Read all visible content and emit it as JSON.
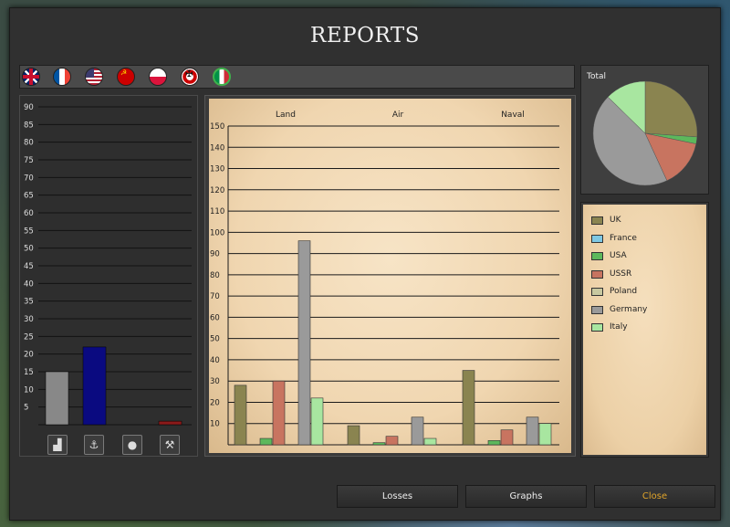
{
  "window": {
    "title": "REPORTS"
  },
  "nations": [
    {
      "name": "uk-flag-icon"
    },
    {
      "name": "france-flag-icon"
    },
    {
      "name": "usa-flag-icon"
    },
    {
      "name": "ussr-flag-icon"
    },
    {
      "name": "poland-flag-icon"
    },
    {
      "name": "germany-flag-icon"
    },
    {
      "name": "italy-flag-icon"
    }
  ],
  "resource_panel": {
    "ticks": [
      "90",
      "85",
      "80",
      "75",
      "70",
      "65",
      "60",
      "55",
      "50",
      "45",
      "40",
      "35",
      "30",
      "25",
      "20",
      "15",
      "10",
      "5"
    ],
    "buttons": [
      {
        "icon": "factory-icon",
        "glyph": "▟"
      },
      {
        "icon": "anchor-icon",
        "glyph": "⚓"
      },
      {
        "icon": "oil-drop-icon",
        "glyph": "💧"
      },
      {
        "icon": "mining-hammers-icon",
        "glyph": "⚒"
      }
    ],
    "colors": {
      "grey": "#888888",
      "navy": "#0a0a80",
      "red": "#8b1a1a"
    }
  },
  "chart_data": [
    {
      "type": "bar",
      "categories": [
        "Land",
        "Air",
        "Naval"
      ],
      "ylim": [
        0,
        150
      ],
      "yticks": [
        "150",
        "140",
        "130",
        "120",
        "110",
        "100",
        "90",
        "80",
        "70",
        "60",
        "50",
        "40",
        "30",
        "20",
        "10"
      ],
      "series": [
        {
          "name": "UK",
          "color": "#8a8450",
          "values": [
            28,
            9,
            35
          ]
        },
        {
          "name": "France",
          "color": "#7ec8e3",
          "values": [
            0,
            0,
            0
          ]
        },
        {
          "name": "USA",
          "color": "#5cb85c",
          "values": [
            3,
            1,
            2
          ]
        },
        {
          "name": "USSR",
          "color": "#c87460",
          "values": [
            30,
            4,
            7
          ]
        },
        {
          "name": "Poland",
          "color": "#c8c8a0",
          "values": [
            0,
            0,
            0
          ]
        },
        {
          "name": "Germany",
          "color": "#9a9a9a",
          "values": [
            96,
            13,
            13
          ]
        },
        {
          "name": "Italy",
          "color": "#a8e6a0",
          "values": [
            22,
            3,
            10
          ]
        }
      ]
    },
    {
      "type": "pie",
      "title": "Total",
      "slices": [
        {
          "name": "UK",
          "color": "#8a8450",
          "value": 72
        },
        {
          "name": "USA",
          "color": "#5cb85c",
          "value": 6
        },
        {
          "name": "USSR",
          "color": "#c87460",
          "value": 41
        },
        {
          "name": "Germany",
          "color": "#9a9a9a",
          "value": 122
        },
        {
          "name": "Italy",
          "color": "#a8e6a0",
          "value": 35
        }
      ]
    },
    {
      "type": "bar",
      "ylim": [
        0,
        90
      ],
      "values": [
        15,
        22,
        0,
        1
      ],
      "colors": [
        "#888888",
        "#0a0a80",
        "#888888",
        "#8b1a1a"
      ]
    }
  ],
  "legend": [
    {
      "name": "UK",
      "color": "#8a8450"
    },
    {
      "name": "France",
      "color": "#7ec8e3"
    },
    {
      "name": "USA",
      "color": "#5cb85c"
    },
    {
      "name": "USSR",
      "color": "#c87460"
    },
    {
      "name": "Poland",
      "color": "#c8c8a0"
    },
    {
      "name": "Germany",
      "color": "#9a9a9a"
    },
    {
      "name": "Italy",
      "color": "#a8e6a0"
    }
  ],
  "buttons": {
    "losses": "Losses",
    "graphs": "Graphs",
    "close": "Close"
  }
}
